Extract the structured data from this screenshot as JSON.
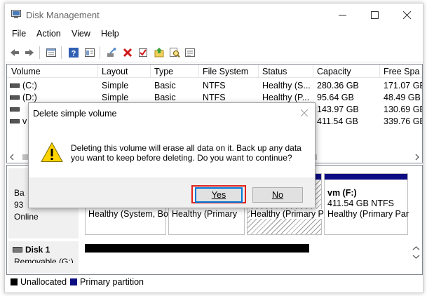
{
  "window": {
    "title": "Disk Management",
    "icon": "disk-management-icon"
  },
  "menu": [
    "File",
    "Action",
    "View",
    "Help"
  ],
  "toolbar": {
    "icons": [
      "back-icon",
      "forward-icon",
      "properties-icon",
      "help-icon",
      "console-icon",
      "connect-icon",
      "delete-icon",
      "check-icon",
      "refresh-icon",
      "search-icon",
      "list-icon"
    ]
  },
  "volume_table": {
    "columns": [
      "Volume",
      "Layout",
      "Type",
      "File System",
      "Status",
      "Capacity",
      "Free Spa"
    ],
    "rows": [
      [
        "(C:)",
        "Simple",
        "Basic",
        "NTFS",
        "Healthy (S...",
        "280.36 GB",
        "171.07 GB"
      ],
      [
        "(D:)",
        "Simple",
        "Basic",
        "NTFS",
        "Healthy (P...",
        "95.64 GB",
        "48.49 GB"
      ],
      [
        "",
        "",
        "",
        "",
        "",
        "143.97 GB",
        "130.69 GB"
      ],
      [
        "v",
        "",
        "",
        "",
        "",
        "411.54 GB",
        "339.76 GB"
      ]
    ]
  },
  "disks": {
    "disk0": {
      "label_partial": "Ba",
      "size_partial": "93",
      "status": "Online",
      "partitions": [
        {
          "status": "Healthy (System, Bo"
        },
        {
          "status": "Healthy (Primary"
        },
        {
          "status": "Healthy (Primary P"
        },
        {
          "name": "vm  (F:)",
          "size": "411.54 GB NTFS",
          "status": "Healthy (Primary Par"
        }
      ]
    },
    "disk1": {
      "label": "Disk 1",
      "type_partial": "Removable (G:)"
    }
  },
  "legend": [
    {
      "label": "Unallocated",
      "color": "#000000"
    },
    {
      "label": "Primary partition",
      "color": "#0d0d83"
    }
  ],
  "dialog": {
    "title": "Delete simple volume",
    "message_line1": "Deleting this volume will erase all data on it. Back up any data",
    "message_line2": "you want to keep before deleting. Do you want to continue?",
    "yes_label": "Yes",
    "no_label": "No",
    "highlight_color": "#e0221d"
  }
}
